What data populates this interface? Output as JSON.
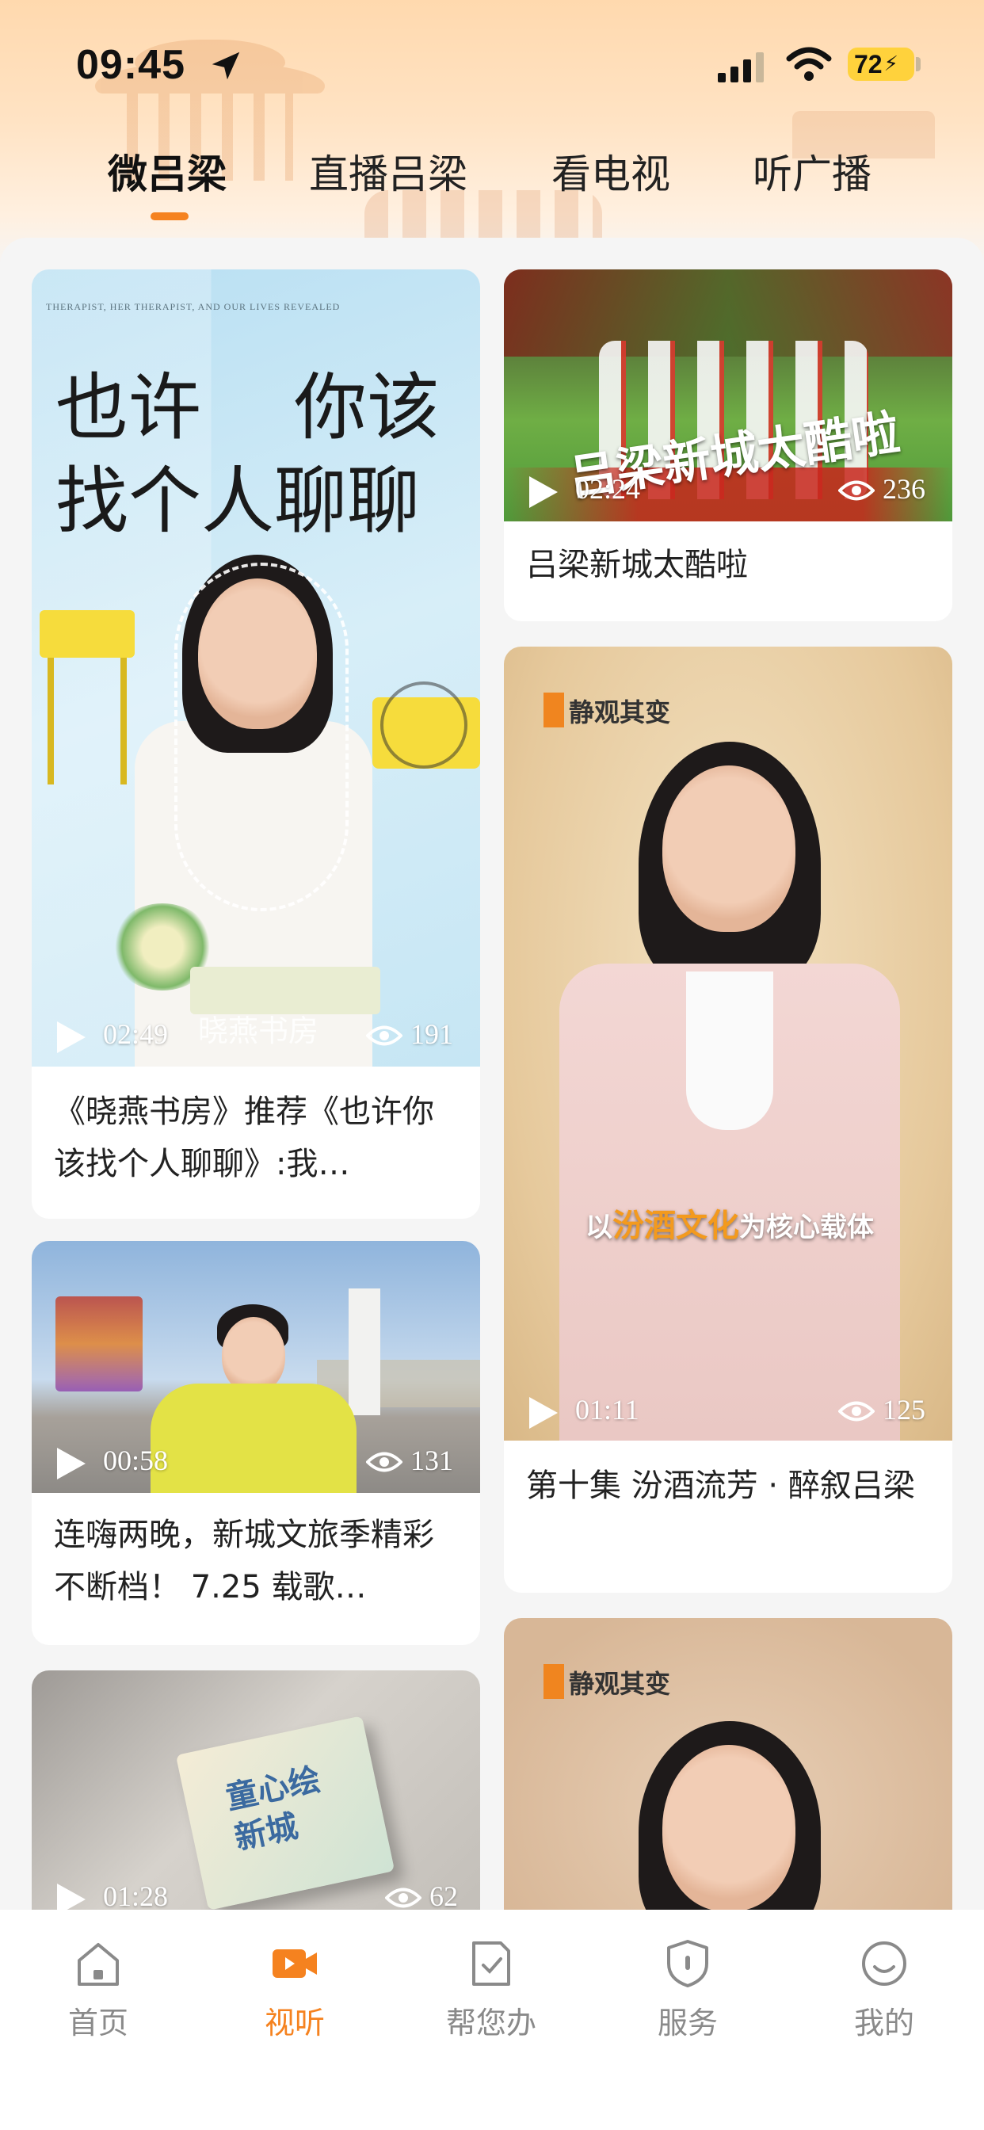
{
  "status_bar": {
    "time": "09:45",
    "battery": "72",
    "icons": [
      "location-arrow-icon",
      "signal-icon",
      "wifi-icon",
      "battery-icon"
    ]
  },
  "tabs": [
    {
      "label": "微吕梁",
      "active": true
    },
    {
      "label": "直播吕梁",
      "active": false
    },
    {
      "label": "看电视",
      "active": false
    },
    {
      "label": "听广播",
      "active": false
    }
  ],
  "videos": [
    {
      "title": "《晓燕书房》推荐《也许你该找个人聊聊》:我…",
      "duration": "02:49",
      "views": "191",
      "overlay_line1": "也许    你该",
      "overlay_line2": "找个人聊聊",
      "overlay_small": "THERAPIST, HER THERAPIST, AND OUR LIVES REVEALED",
      "watermark": "晓燕书房"
    },
    {
      "title": "吕梁新城太酷啦",
      "duration": "02:24",
      "views": "236",
      "overlay_text": "吕梁新城太酷啦"
    },
    {
      "title": "第十集 汾酒流芳 · 醉叙吕梁",
      "duration": "01:11",
      "views": "125",
      "logo": "静观其变",
      "caption_prefix": "以",
      "caption_highlight": "汾酒文化",
      "caption_suffix": "为核心载体"
    },
    {
      "title": "连嗨两晚，新城文旅季精彩不断档！ 7.25 载歌…",
      "duration": "00:58",
      "views": "131"
    },
    {
      "title": "",
      "duration": "01:28",
      "views": "62",
      "book_text": "童心绘新城"
    },
    {
      "title": "",
      "logo": "静观其变"
    }
  ],
  "bottom_nav": [
    {
      "label": "首页",
      "icon": "home-icon",
      "active": false
    },
    {
      "label": "视听",
      "icon": "video-camera-icon",
      "active": true
    },
    {
      "label": "帮您办",
      "icon": "document-check-icon",
      "active": false
    },
    {
      "label": "服务",
      "icon": "shield-icon",
      "active": false
    },
    {
      "label": "我的",
      "icon": "smiley-profile-icon",
      "active": false
    }
  ],
  "colors": {
    "accent": "#f5821f",
    "header_gradient_top": "#ffd9ae",
    "nav_inactive": "#8a8a8a",
    "battery": "#ffd23c"
  }
}
